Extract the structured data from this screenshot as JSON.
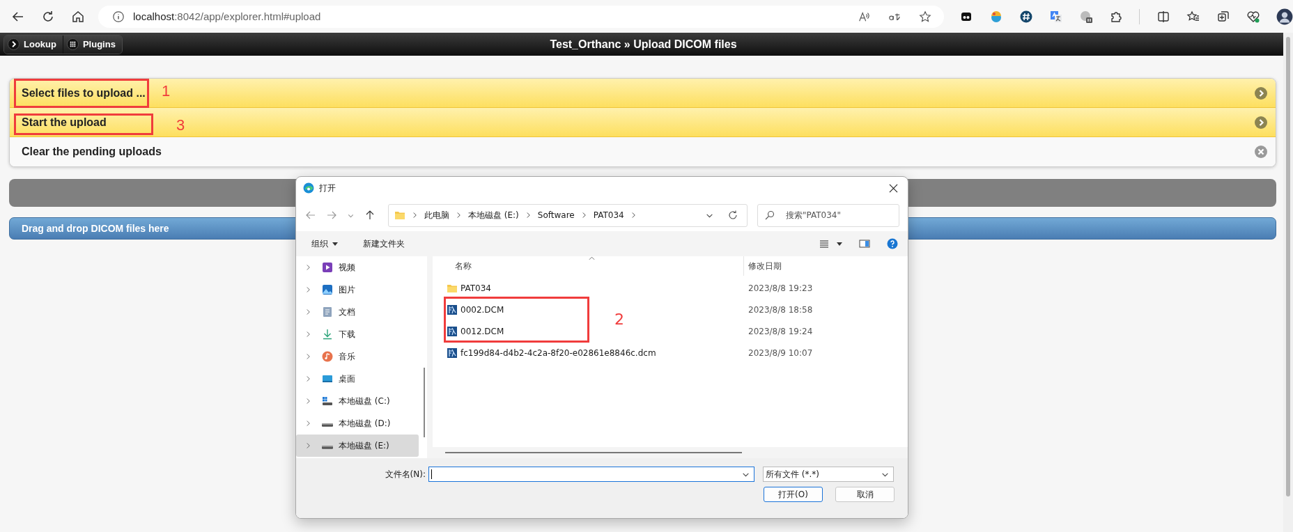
{
  "browser": {
    "url": {
      "host": "localhost",
      "rest": ":8042/app/explorer.html#upload"
    }
  },
  "app_header": {
    "buttons": [
      {
        "label": "Lookup",
        "kind": "lookup"
      },
      {
        "label": "Plugins",
        "kind": "plugins"
      }
    ],
    "title": "Test_Orthanc » Upload DICOM files"
  },
  "actions": [
    {
      "label": "Select files to upload ...",
      "kind": "highlighted",
      "annotation": "1"
    },
    {
      "label": "Start the upload",
      "kind": "highlighted",
      "annotation": "3"
    },
    {
      "label": "Clear the pending uploads",
      "kind": "plain"
    }
  ],
  "progress": {
    "level": 0
  },
  "drop_zone": {
    "label": "Drag and drop DICOM files here"
  },
  "dialog": {
    "title": "打开",
    "breadcrumb": [
      "此电脑",
      "本地磁盘 (E:)",
      "Software",
      "PAT034"
    ],
    "search": {
      "placeholder": "搜索\"PAT034\""
    },
    "toolbar": {
      "organize": "组织",
      "new_folder": "新建文件夹"
    },
    "nav_items": [
      {
        "label": "视频",
        "kind": "videos",
        "selected": false
      },
      {
        "label": "图片",
        "kind": "pictures",
        "selected": false
      },
      {
        "label": "文档",
        "kind": "documents",
        "selected": false
      },
      {
        "label": "下载",
        "kind": "downloads",
        "selected": false
      },
      {
        "label": "音乐",
        "kind": "music",
        "selected": false
      },
      {
        "label": "桌面",
        "kind": "desktop",
        "selected": false
      },
      {
        "label": "本地磁盘 (C:)",
        "kind": "system-drive",
        "selected": false
      },
      {
        "label": "本地磁盘 (D:)",
        "kind": "drive",
        "selected": false
      },
      {
        "label": "本地磁盘 (E:)",
        "kind": "drive",
        "selected": true
      }
    ],
    "columns": [
      "名称",
      "修改日期"
    ],
    "files": [
      {
        "name": "PAT034",
        "date": "2023/8/8 19:23",
        "kind": "folder",
        "marked": false
      },
      {
        "name": "0002.DCM",
        "date": "2023/8/8 18:58",
        "kind": "dicom",
        "marked": true
      },
      {
        "name": "0012.DCM",
        "date": "2023/8/8 19:24",
        "kind": "dicom",
        "marked": true
      },
      {
        "name": "fc199d84-d4b2-4c2a-8f20-e02861e8846c.dcm",
        "date": "2023/8/9 10:07",
        "kind": "dicom",
        "marked": false
      }
    ],
    "files_annotation": "2",
    "filename_label": "文件名(N):",
    "file_type": "所有文件 (*.*)",
    "buttons": [
      {
        "label": "打开(O)",
        "primary": true
      },
      {
        "label": "取消",
        "primary": false
      }
    ]
  }
}
